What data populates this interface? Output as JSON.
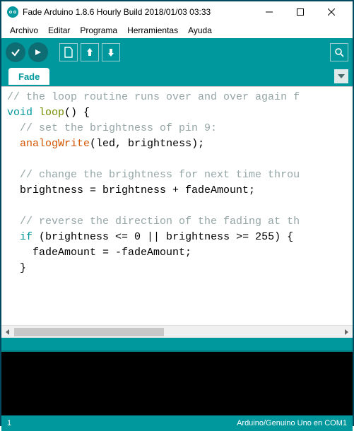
{
  "window": {
    "title": "Fade Arduino 1.8.6 Hourly Build 2018/01/03 03:33"
  },
  "menu": {
    "file": "Archivo",
    "edit": "Editar",
    "sketch": "Programa",
    "tools": "Herramientas",
    "help": "Ayuda"
  },
  "tabs": {
    "current": "Fade"
  },
  "code": {
    "l1_c": "// the loop routine runs over and over again f",
    "l2_k": "void",
    "l2_fn": "loop",
    "l2_r": "() {",
    "l3_c": "  // set the brightness of pin 9:",
    "l4_i": "  ",
    "l4_fn": "analogWrite",
    "l4_r": "(led, brightness);",
    "blank": " ",
    "l6_c": "  // change the brightness for next time throu",
    "l7": "  brightness = brightness + fadeAmount;",
    "l9_c": "  // reverse the direction of the fading at th",
    "l10_i": "  ",
    "l10_k": "if",
    "l10_r": " (brightness <= 0 || brightness >= 255) {",
    "l11": "    fadeAmount = -fadeAmount;",
    "l12": "  }"
  },
  "status": {
    "line": "1",
    "board": "Arduino/Genuino Uno en COM1"
  }
}
